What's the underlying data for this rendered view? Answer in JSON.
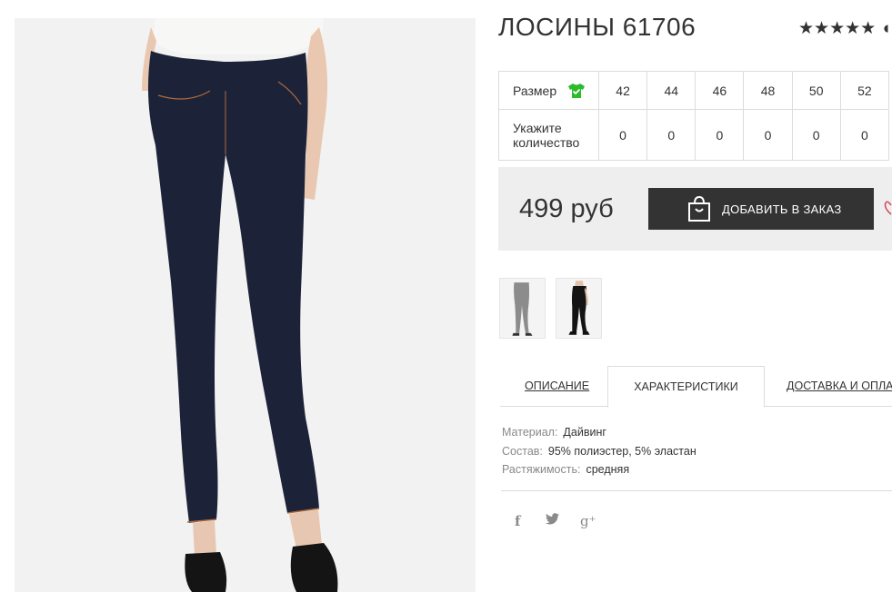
{
  "product": {
    "title": "ЛОСИНЫ 61706",
    "rating_stars": "★★★★★",
    "rating_extra": "◖"
  },
  "sizes": {
    "size_label": "Размер",
    "qty_label_line1": "Укажите",
    "qty_label_line2": "количество",
    "values": [
      "42",
      "44",
      "46",
      "48",
      "50",
      "52"
    ],
    "quantities": [
      "0",
      "0",
      "0",
      "0",
      "0",
      "0"
    ]
  },
  "price": {
    "amount": "499 руб",
    "add_button": "ДОБАВИТЬ В ЗАКАЗ"
  },
  "tabs": {
    "description": "ОПИСАНИЕ",
    "characteristics": "ХАРАКТЕРИСТИКИ",
    "delivery": "ДОСТАВКА И ОПЛАТА"
  },
  "specs": [
    {
      "key": "Материал:",
      "value": "Дайвинг"
    },
    {
      "key": "Состав:",
      "value": "95% полиэстер, 5% эластан"
    },
    {
      "key": "Растяжимость:",
      "value": "средняя"
    }
  ],
  "social": {
    "facebook": "f",
    "twitter": "🐦",
    "googleplus": "g⁺"
  },
  "colors": {
    "button_bg": "#333333",
    "price_box_bg": "#eeeeee",
    "shirt_icon": "#2bbb2b",
    "heart": "#d9435a"
  }
}
